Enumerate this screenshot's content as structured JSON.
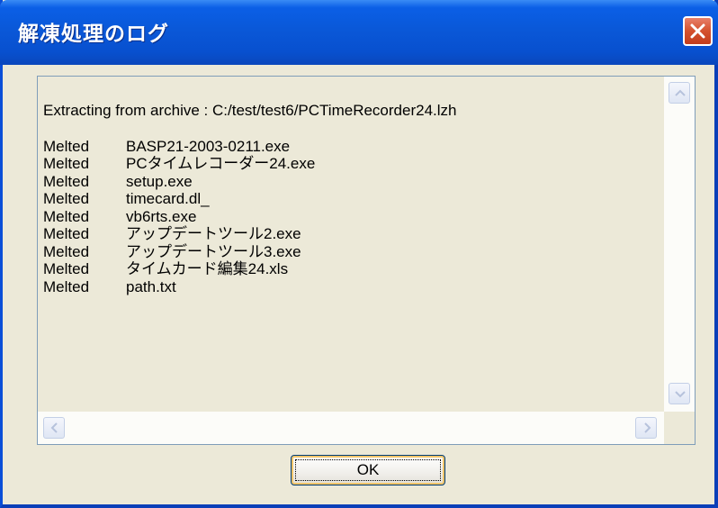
{
  "window": {
    "title": "解凍処理のログ"
  },
  "log": {
    "header": "Extracting from archive : C:/test/test6/PCTimeRecorder24.lzh",
    "entries": [
      {
        "status": "Melted",
        "file": "BASP21-2003-0211.exe"
      },
      {
        "status": "Melted",
        "file": "PCタイムレコーダー24.exe"
      },
      {
        "status": "Melted",
        "file": "setup.exe"
      },
      {
        "status": "Melted",
        "file": "timecard.dl_"
      },
      {
        "status": "Melted",
        "file": "vb6rts.exe"
      },
      {
        "status": "Melted",
        "file": "アップデートツール2.exe"
      },
      {
        "status": "Melted",
        "file": "アップデートツール3.exe"
      },
      {
        "status": "Melted",
        "file": "タイムカード編集24.xls"
      },
      {
        "status": "Melted",
        "file": "path.txt"
      }
    ]
  },
  "buttons": {
    "ok_label": "OK"
  },
  "icons": {
    "close": "close-icon",
    "scroll_up": "arrow-up-icon",
    "scroll_down": "arrow-down-icon",
    "scroll_left": "arrow-left-icon",
    "scroll_right": "arrow-right-icon"
  },
  "colors": {
    "titlebar": "#0a58d8",
    "close_button": "#d4512e",
    "dialog_background": "#ece9d8"
  }
}
